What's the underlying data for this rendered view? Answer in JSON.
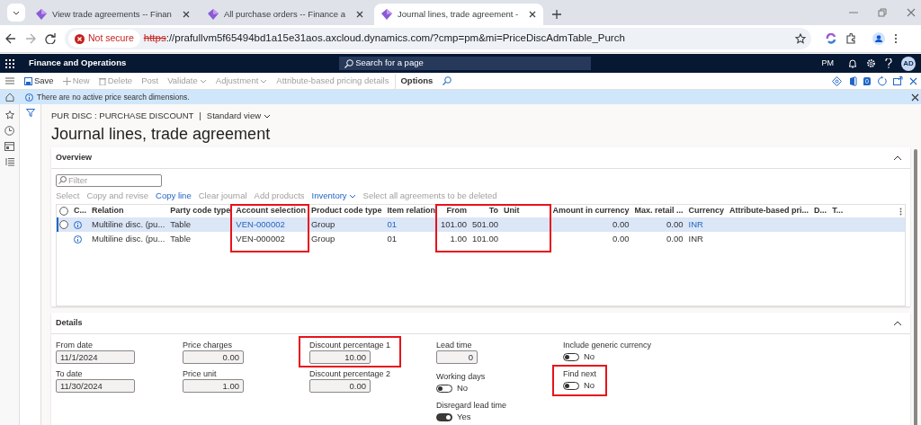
{
  "browser": {
    "tabs": [
      {
        "title": "View trade agreements -- Finan",
        "selected": false
      },
      {
        "title": "All purchase orders -- Finance a",
        "selected": false
      },
      {
        "title": "Journal lines, trade agreement -",
        "selected": true
      }
    ],
    "security": "Not secure",
    "url_scheme": "https",
    "url_rest": "://prafullvm5f65494bd1a15e31aos.axcloud.dynamics.com/?cmp=pm&mi=PriceDiscAdmTable_Purch"
  },
  "app_bar": {
    "title": "Finance and Operations",
    "search": "Search for a page",
    "company": "PM",
    "avatar": "AD"
  },
  "toolbar": [
    {
      "label": "Save",
      "kind": "save",
      "disabled": false
    },
    {
      "label": "New",
      "kind": "new",
      "disabled": true
    },
    {
      "label": "Delete",
      "kind": "delete",
      "disabled": true
    },
    {
      "label": "Post",
      "kind": "plain",
      "disabled": true
    },
    {
      "label": "Validate",
      "kind": "menu",
      "disabled": true
    },
    {
      "label": "Adjustment",
      "kind": "menu",
      "disabled": true
    },
    {
      "label": "Attribute-based pricing details",
      "kind": "plain",
      "disabled": true
    },
    {
      "label": "Options",
      "kind": "tab",
      "disabled": false
    }
  ],
  "toolbar_badge": "0",
  "message_bar": {
    "text": "There are no active price search dimensions."
  },
  "breadcrumb": {
    "path": "PUR DISC : PURCHASE DISCOUNT",
    "separator": "|",
    "view": "Standard view"
  },
  "title": "Journal lines, trade agreement",
  "overview": {
    "title": "Overview",
    "expanded": true,
    "filter": {
      "placeholder": "Filter"
    },
    "actions": [
      {
        "label": "Select",
        "disabled": true,
        "menu": false
      },
      {
        "label": "Copy and revise",
        "disabled": true,
        "menu": false
      },
      {
        "label": "Copy line",
        "disabled": false,
        "menu": false
      },
      {
        "label": "Clear journal",
        "disabled": true,
        "menu": false
      },
      {
        "label": "Add products",
        "disabled": true,
        "menu": false
      },
      {
        "label": "Inventory",
        "disabled": false,
        "menu": true
      },
      {
        "label": "Select all agreements to be deleted",
        "disabled": true,
        "menu": false
      }
    ],
    "table": {
      "all_selected": false,
      "columns": [
        {
          "label": "C...",
          "kind": "icon"
        },
        {
          "label": "Relation",
          "kind": "text"
        },
        {
          "label": "Party code type",
          "kind": "text"
        },
        {
          "label": "Account selection",
          "kind": "text",
          "link": true,
          "highlighted": true
        },
        {
          "label": "Product code type",
          "kind": "text"
        },
        {
          "label": "Item relation",
          "kind": "text",
          "link": true
        },
        {
          "label": "From",
          "kind": "number",
          "highlighted": true
        },
        {
          "label": "To",
          "kind": "number",
          "highlighted": true
        },
        {
          "label": "Unit",
          "kind": "text",
          "highlighted": true
        },
        {
          "label": "Amount in currency",
          "kind": "number"
        },
        {
          "label": "Max. retail ...",
          "kind": "number"
        },
        {
          "label": "Currency",
          "kind": "text",
          "link": true
        },
        {
          "label": "Attribute-based pri...",
          "kind": "text"
        },
        {
          "label": "D...",
          "kind": "text"
        },
        {
          "label": "T...",
          "kind": "text"
        }
      ],
      "rows": [
        {
          "selected": true,
          "cells": [
            null,
            "Multiline disc. (pu...",
            "Table",
            "VEN-000002",
            "Group",
            "01",
            "101.00",
            "501.00",
            null,
            "0.00",
            "0.00",
            "INR",
            null,
            null,
            null
          ]
        },
        {
          "selected": false,
          "cells": [
            null,
            "Multiline disc. (pu...",
            "Table",
            "VEN-000002",
            "Group",
            "01",
            "1.00",
            "101.00",
            null,
            "0.00",
            "0.00",
            "INR",
            null,
            null,
            null
          ]
        }
      ]
    }
  },
  "details": {
    "title": "Details",
    "expanded": true,
    "columns": [
      [
        {
          "label": "From date",
          "kind": "text",
          "value": "11/1/2024"
        },
        {
          "label": "To date",
          "kind": "text",
          "value": "11/30/2024"
        }
      ],
      [
        {
          "label": "Price charges",
          "kind": "number",
          "value": "0.00"
        },
        {
          "label": "Price unit",
          "kind": "number",
          "value": "1.00"
        }
      ],
      [
        {
          "label": "Discount percentage 1",
          "kind": "number",
          "value": "10.00",
          "highlighted": true
        },
        {
          "label": "Discount percentage 2",
          "kind": "number",
          "value": "0.00"
        }
      ],
      [
        {
          "label": "Lead time",
          "kind": "number",
          "value": "0"
        },
        {
          "label": "Working days",
          "kind": "toggle",
          "on": false,
          "value": "No"
        },
        {
          "label": "Disregard lead time",
          "kind": "toggle",
          "on": true,
          "value": "Yes"
        }
      ],
      [
        {
          "label": "Include generic currency",
          "kind": "toggle",
          "on": false,
          "value": "No"
        },
        {
          "label": "Find next",
          "kind": "toggle",
          "on": false,
          "value": "No",
          "highlighted": true
        }
      ]
    ]
  }
}
